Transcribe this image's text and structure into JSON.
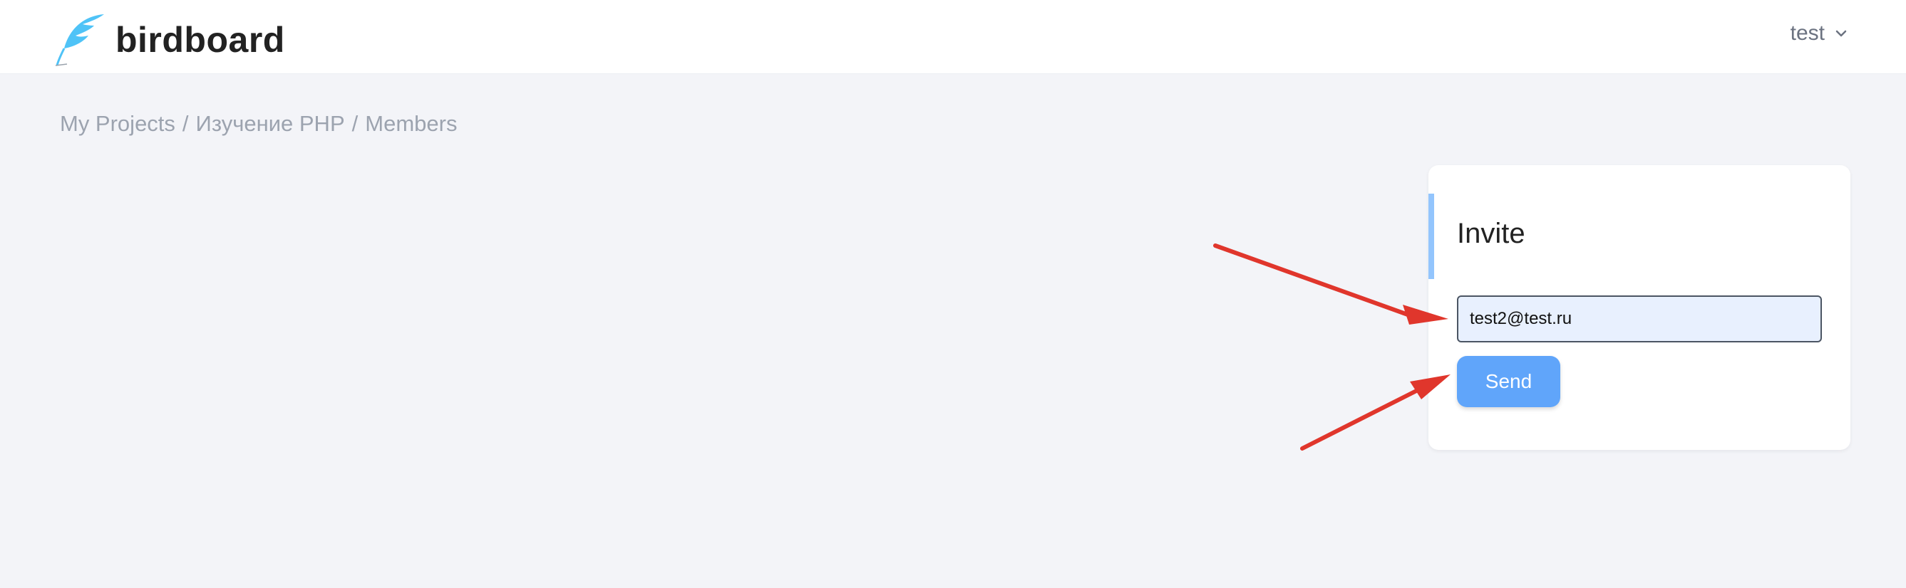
{
  "header": {
    "brand_name": "birdboard",
    "logo_icon": "feather-icon",
    "user_name": "test",
    "user_menu_icon": "chevron-down-icon"
  },
  "breadcrumb": {
    "items": [
      "My Projects",
      "Изучение PHP",
      "Members"
    ],
    "separator": "/"
  },
  "invite": {
    "title": "Invite",
    "email_value": "test2@test.ru",
    "send_label": "Send"
  },
  "colors": {
    "accent": "#60a5fa",
    "accent_bar": "#93c5fd",
    "logo": "#4fc3f7",
    "annotation_arrow": "#e0362c",
    "background": "#f3f4f8"
  }
}
